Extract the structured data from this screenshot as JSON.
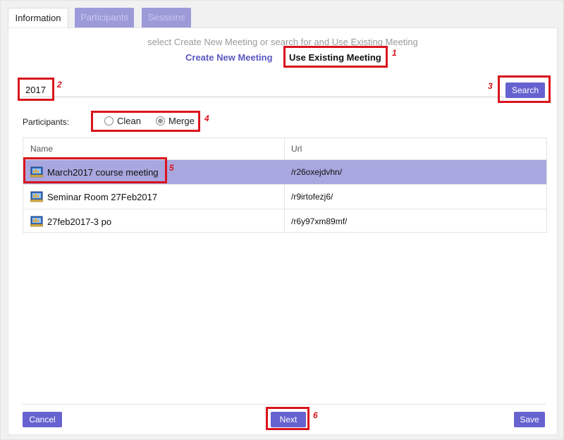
{
  "tabs": [
    {
      "label": "Information",
      "active": true
    },
    {
      "label": "Participants",
      "active": false
    },
    {
      "label": "Sessions",
      "active": false
    }
  ],
  "hint_text": "select Create New Meeting or search for and Use Existing Meeting",
  "mode": {
    "create_label": "Create New Meeting",
    "use_existing_label": "Use Existing Meeting"
  },
  "search": {
    "value": "2017",
    "button_label": "Search"
  },
  "participants": {
    "label": "Participants:",
    "options": [
      {
        "label": "Clean",
        "checked": false
      },
      {
        "label": "Merge",
        "checked": true
      }
    ]
  },
  "table": {
    "columns": [
      "Name",
      "Url"
    ],
    "rows": [
      {
        "name": "March2017 course meeting",
        "url": "/r26oxejdvhn/",
        "selected": true
      },
      {
        "name": "Seminar Room 27Feb2017",
        "url": "/r9irtofezj6/",
        "selected": false
      },
      {
        "name": "27feb2017-3 po",
        "url": "/r6y97xm89mf/",
        "selected": false
      }
    ]
  },
  "footer": {
    "cancel_label": "Cancel",
    "next_label": "Next",
    "save_label": "Save"
  },
  "annotations": [
    "1",
    "2",
    "3",
    "4",
    "5",
    "6"
  ],
  "colors": {
    "accent": "#6662d0",
    "selected_row": "#a9a7df",
    "highlight": "#d9141c",
    "tab_inactive": "#9c9ad8"
  }
}
